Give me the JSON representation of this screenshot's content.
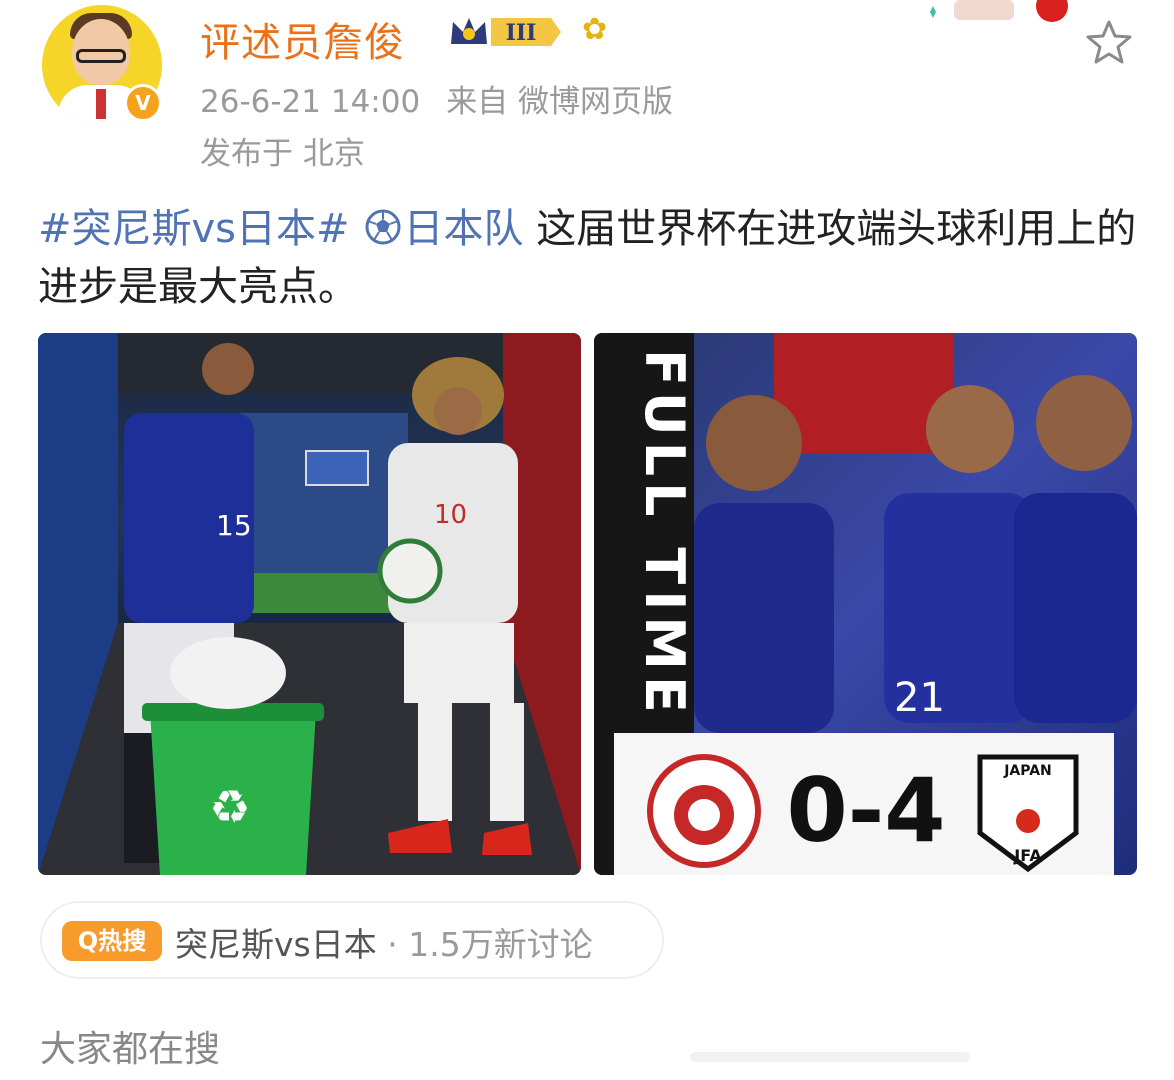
{
  "post": {
    "author": {
      "name": "评述员詹俊",
      "level_badge": "III",
      "verified_mark": "V"
    },
    "meta": {
      "timestamp": "26-6-21 14:00",
      "source": "来自 微博网页版",
      "location": "发布于 北京"
    },
    "body": {
      "topic_tag": "#突尼斯vs日本#",
      "team_tag": "日本队",
      "text": " 这届世界杯在进攻端头球利用上的进步是最大亮点。"
    },
    "images": [
      {
        "caption_jersey_left": "15",
        "caption_jersey_right": "10"
      },
      {
        "banner": "FULL TIME",
        "score": "0-4",
        "away_label": "JAPAN",
        "away_abbr": "JFA",
        "player_number": "21"
      }
    ],
    "hot_search": {
      "badge": "Q热搜",
      "topic": "突尼斯vs日本",
      "separator": " · ",
      "count": "1.5万新讨论"
    },
    "footer_label": "大家都在搜"
  },
  "colors": {
    "username": "#e8711a",
    "topic": "#4f73b5",
    "meta": "#9a9a9a",
    "hot_badge": "#f79b2c"
  },
  "icons": [
    "star-icon",
    "soccer-ball-icon",
    "crown-badge-icon",
    "sunflower-icon",
    "recycle-icon"
  ]
}
